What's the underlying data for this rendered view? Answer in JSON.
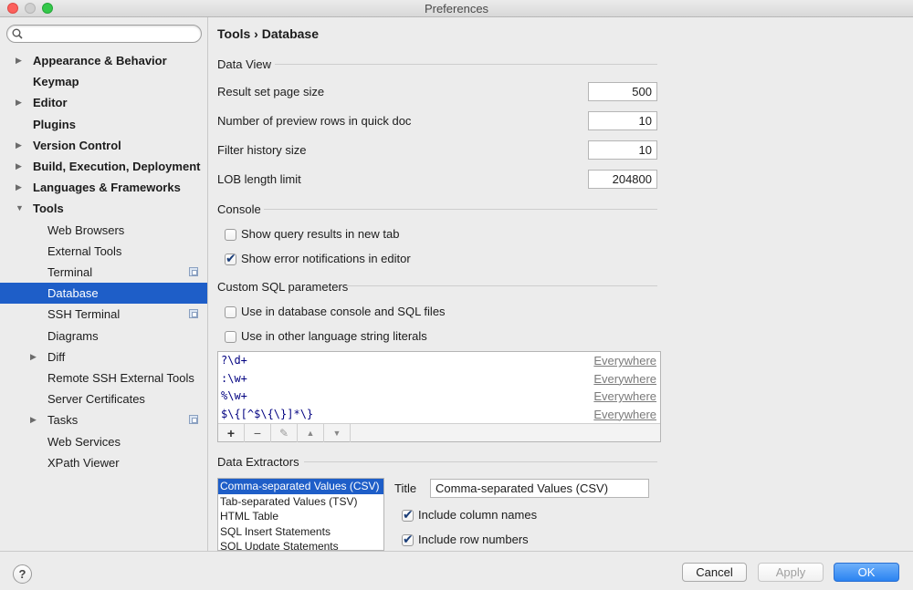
{
  "window": {
    "title": "Preferences"
  },
  "search": {
    "placeholder": "",
    "value": ""
  },
  "sidebar": {
    "items": [
      {
        "label": "Appearance & Behavior",
        "bold": true,
        "expandable": true,
        "expanded": false,
        "indent": 0
      },
      {
        "label": "Keymap",
        "bold": true,
        "expandable": false,
        "indent": 0
      },
      {
        "label": "Editor",
        "bold": true,
        "expandable": true,
        "expanded": false,
        "indent": 0
      },
      {
        "label": "Plugins",
        "bold": true,
        "expandable": false,
        "indent": 0
      },
      {
        "label": "Version Control",
        "bold": true,
        "expandable": true,
        "expanded": false,
        "indent": 0
      },
      {
        "label": "Build, Execution, Deployment",
        "bold": true,
        "expandable": true,
        "expanded": false,
        "indent": 0
      },
      {
        "label": "Languages & Frameworks",
        "bold": true,
        "expandable": true,
        "expanded": false,
        "indent": 0
      },
      {
        "label": "Tools",
        "bold": true,
        "expandable": true,
        "expanded": true,
        "indent": 0
      },
      {
        "label": "Web Browsers",
        "bold": false,
        "expandable": false,
        "indent": 1
      },
      {
        "label": "External Tools",
        "bold": false,
        "expandable": false,
        "indent": 1
      },
      {
        "label": "Terminal",
        "bold": false,
        "expandable": false,
        "indent": 1,
        "project_icon": true
      },
      {
        "label": "Database",
        "bold": false,
        "expandable": false,
        "indent": 1,
        "selected": true
      },
      {
        "label": "SSH Terminal",
        "bold": false,
        "expandable": false,
        "indent": 1,
        "project_icon": true
      },
      {
        "label": "Diagrams",
        "bold": false,
        "expandable": false,
        "indent": 1
      },
      {
        "label": "Diff",
        "bold": false,
        "expandable": true,
        "expanded": false,
        "indent": 1
      },
      {
        "label": "Remote SSH External Tools",
        "bold": false,
        "expandable": false,
        "indent": 1
      },
      {
        "label": "Server Certificates",
        "bold": false,
        "expandable": false,
        "indent": 1
      },
      {
        "label": "Tasks",
        "bold": false,
        "expandable": true,
        "expanded": false,
        "indent": 1,
        "project_icon": true
      },
      {
        "label": "Web Services",
        "bold": false,
        "expandable": false,
        "indent": 1
      },
      {
        "label": "XPath Viewer",
        "bold": false,
        "expandable": false,
        "indent": 1
      }
    ]
  },
  "main": {
    "breadcrumb": "Tools › Database",
    "data_view": {
      "header": "Data View",
      "fields": [
        {
          "label": "Result set page size",
          "value": "500"
        },
        {
          "label": "Number of preview rows in quick doc",
          "value": "10"
        },
        {
          "label": "Filter history size",
          "value": "10"
        },
        {
          "label": "LOB length limit",
          "value": "204800"
        }
      ]
    },
    "console": {
      "header": "Console",
      "options": [
        {
          "label": "Show query results in new tab",
          "checked": false
        },
        {
          "label": "Show error notifications in editor",
          "checked": true
        }
      ]
    },
    "custom_sql": {
      "header": "Custom SQL parameters",
      "options": [
        {
          "label": "Use in database console and SQL files",
          "checked": false
        },
        {
          "label": "Use in other language string literals",
          "checked": false
        }
      ],
      "parameters": [
        {
          "pattern": "?\\d+",
          "scope": "Everywhere"
        },
        {
          "pattern": ":\\w+",
          "scope": "Everywhere"
        },
        {
          "pattern": "%\\w+",
          "scope": "Everywhere"
        },
        {
          "pattern": "$\\{[^$\\{\\}]*\\}",
          "scope": "Everywhere"
        }
      ],
      "toolbar": {
        "add": "+",
        "remove": "−",
        "edit": "✎",
        "up": "▲",
        "down": "▼"
      }
    },
    "data_extractors": {
      "header": "Data Extractors",
      "items": [
        {
          "label": "Comma-separated Values (CSV)",
          "selected": true
        },
        {
          "label": "Tab-separated Values (TSV)"
        },
        {
          "label": "HTML Table"
        },
        {
          "label": "SQL Insert Statements"
        },
        {
          "label": "SQL Update Statements"
        }
      ],
      "title_label": "Title",
      "title_value": "Comma-separated Values (CSV)",
      "options": [
        {
          "label": "Include column names",
          "checked": true
        },
        {
          "label": "Include row numbers",
          "checked": true
        }
      ]
    }
  },
  "footer": {
    "help": "?",
    "cancel": "Cancel",
    "apply": "Apply",
    "ok": "OK"
  },
  "colors": {
    "selection": "#1e5ec8",
    "ok_button": "#2a83f1"
  }
}
